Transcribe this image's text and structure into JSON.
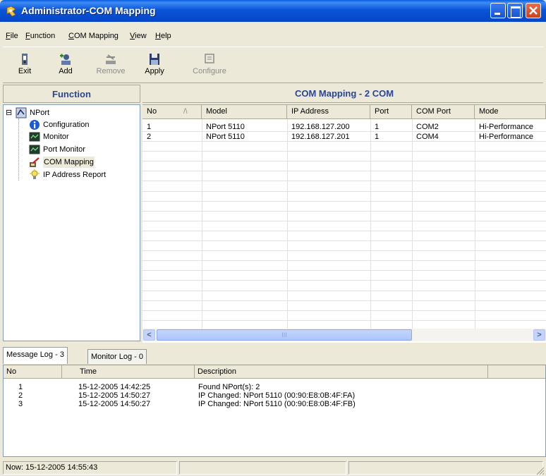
{
  "window": {
    "title": "Administrator-COM Mapping"
  },
  "menu": [
    {
      "label": "File"
    },
    {
      "label": "Function"
    },
    {
      "label": "COM Mapping"
    },
    {
      "label": "View"
    },
    {
      "label": "Help"
    }
  ],
  "toolbar": {
    "exit": {
      "label": "Exit",
      "icon": "exit-icon",
      "enabled": true
    },
    "add": {
      "label": "Add",
      "icon": "add-icon",
      "enabled": true
    },
    "remove": {
      "label": "Remove",
      "icon": "remove-icon",
      "enabled": false
    },
    "apply": {
      "label": "Apply",
      "icon": "floppy-icon",
      "enabled": true
    },
    "configure": {
      "label": "Configure",
      "icon": "configure-icon",
      "enabled": false
    }
  },
  "function_panel": {
    "title": "Function",
    "tree": {
      "root": {
        "label": "NPort",
        "icon": "nport-icon",
        "expander": "⊟"
      },
      "children": [
        {
          "label": "Configuration",
          "icon": "info-icon"
        },
        {
          "label": "Monitor",
          "icon": "monitor-icon"
        },
        {
          "label": "Port Monitor",
          "icon": "monitor-icon"
        },
        {
          "label": "COM Mapping",
          "icon": "com-mapping-icon",
          "selected": true
        },
        {
          "label": "IP Address Report",
          "icon": "lightbulb-icon"
        }
      ]
    }
  },
  "mapping_panel": {
    "title": "COM Mapping - 2 COM",
    "columns": [
      "No",
      "Model",
      "IP Address",
      "Port",
      "COM Port",
      "Mode"
    ],
    "sort_indicator": "/\\",
    "rows": [
      [
        "1",
        "NPort 5110",
        "192.168.127.200",
        "1",
        "COM2",
        "Hi-Performance"
      ],
      [
        "2",
        "NPort 5110",
        "192.168.127.201",
        "1",
        "COM4",
        "Hi-Performance"
      ]
    ],
    "scrollbar": {
      "left_arrow": "<",
      "right_arrow": ">",
      "thumb_grip": "III"
    }
  },
  "log_tabs": [
    {
      "label": "Message Log - 3",
      "active": true
    },
    {
      "label": "Monitor Log - 0",
      "active": false
    }
  ],
  "log": {
    "columns": [
      "No",
      "Time",
      "Description"
    ],
    "rows": [
      [
        "1",
        "15-12-2005 14:42:25",
        "Found NPort(s): 2"
      ],
      [
        "2",
        "15-12-2005 14:50:27",
        "IP Changed: NPort 5110 (00:90:E8:0B:4F:FA)"
      ],
      [
        "3",
        "15-12-2005 14:50:27",
        "IP Changed: NPort 5110 (00:90:E8:0B:4F:FB)"
      ]
    ]
  },
  "status": {
    "now": "Now: 15-12-2005 14:55:43"
  },
  "colors": {
    "title_blue": "#0a55d8",
    "panel_title": "#2b4596",
    "face": "#ece9d8"
  }
}
